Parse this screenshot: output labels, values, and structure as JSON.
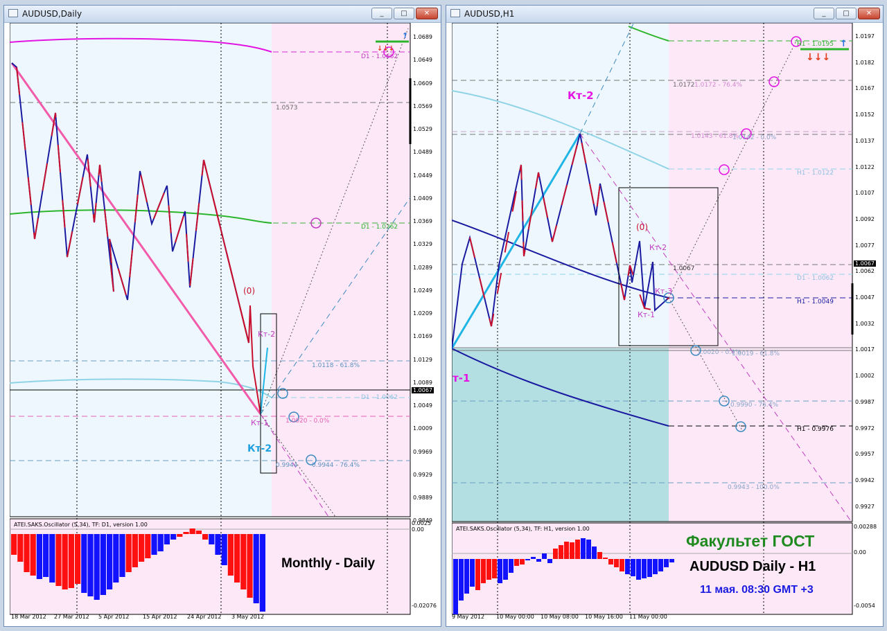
{
  "left_window": {
    "title": "AUDUSD,Daily",
    "buttons": {
      "minimize": "_",
      "maximize": "□",
      "close": "✕"
    },
    "price_axis": [
      "1.0689",
      "1.0649",
      "1.0609",
      "1.0569",
      "1.0529",
      "1.0489",
      "1.0449",
      "1.0409",
      "1.0369",
      "1.0329",
      "1.0289",
      "1.0249",
      "1.0209",
      "1.0169",
      "1.0129",
      "1.0089",
      "1.0049",
      "1.0009",
      "0.9969",
      "0.9929",
      "0.9889",
      "0.9849"
    ],
    "current_price": "1.0067",
    "levels": {
      "d1_top": "D1 - 1.0662",
      "d1_mid": "D1 - 1.0362",
      "d1_low": "D1 - 1.0062",
      "level_0573": "1.0573",
      "fib_618": "1.0118 - 61.8%",
      "fib_0": "1.0020 - 0.0%",
      "fib_764_a": "0.9944",
      "fib_764_b": "0.9944 - 76.4%"
    },
    "markers": {
      "zero": "(0)",
      "kt1": "Кт-1",
      "kt2_small": "Кт-2",
      "kt2_big": "Кт-2"
    },
    "oscillator": {
      "title": "ATEI.SAKS.Oscillator (5,34), TF: D1, version 1.00",
      "axis": [
        "0.0025",
        "0.00",
        "-0.02076"
      ],
      "caption": "Monthly - Daily"
    },
    "x_axis": [
      "18 Mar 2012",
      "27 Mar 2012",
      "5 Apr 2012",
      "15 Apr 2012",
      "24 Apr 2012",
      "3 May 2012"
    ]
  },
  "right_window": {
    "title": "AUDUSD,H1",
    "buttons": {
      "minimize": "_",
      "maximize": "□",
      "close": "✕"
    },
    "price_axis": [
      "1.0197",
      "1.0182",
      "1.0167",
      "1.0152",
      "1.0137",
      "1.0122",
      "1.0107",
      "1.0092",
      "1.0077",
      "1.0062",
      "1.0047",
      "1.0032",
      "1.0017",
      "1.0002",
      "0.9987",
      "0.9972",
      "0.9957",
      "0.9942",
      "0.9927"
    ],
    "current_price": "1.0067",
    "levels": {
      "h1_top": "H1 - 1.0195",
      "lvl_0172": "1.0172",
      "fib_0172": "1.0172 - 76.4%",
      "fib_0143": "1.0143 - 61.8%",
      "fib_0142": "1.0142 - 0.0%",
      "h1_0122": "H1 - 1.0122",
      "lvl_0067": "1.0067",
      "d1_0062": "D1 - 1.0062",
      "h1_0049": "H1 - 1.0049",
      "fib_0020": "1.0020 - 0.0%",
      "fib_0019": "1.0019 - 61.8%",
      "fib_0990": "0.9990 - 76.4%",
      "h1_0976": "H1 - 0.9976",
      "fib_0943": "0.9943 - 100.0%"
    },
    "markers": {
      "zero": "(0)",
      "kt1": "Кт-1",
      "kt2": "Кт-2",
      "kt3": "Кт-3",
      "kt2_big": "Кт-2",
      "kt1_edge": "т-1"
    },
    "oscillator": {
      "title": "ATEI.SAKS.Oscillator (5,34), TF: H1, version 1.00",
      "axis": [
        "0.00288",
        "0.00",
        "-0.0054"
      ]
    },
    "overlay": {
      "line1": "Факультет ГОСТ",
      "line2": "AUDUSD Daily - H1",
      "line3": "11 мая. 08:30 GMT +3"
    },
    "x_axis": [
      "9 May 2012",
      "10 May 00:00",
      "10 May 08:00",
      "10 May 16:00",
      "11 May 00:00"
    ]
  },
  "colors": {
    "bull": "#1a1aa0",
    "bear": "#c8102e",
    "fibPink": "#d84fd8",
    "green": "#2bb52b",
    "cyan": "#1fb5e6",
    "osc_red": "#ff1010",
    "osc_blue": "#1212ff"
  }
}
